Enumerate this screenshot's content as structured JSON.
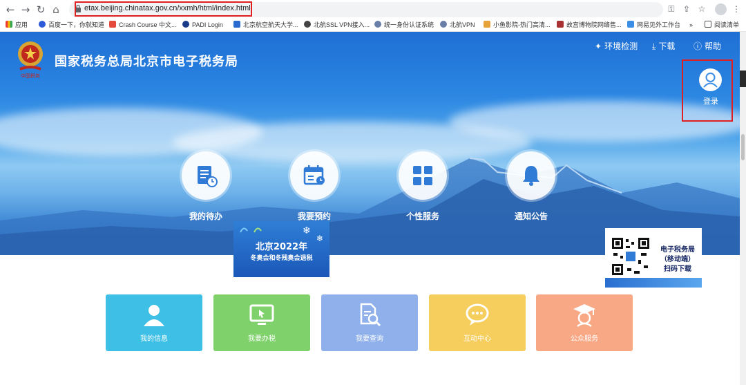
{
  "browser": {
    "url": "etax.beijing.chinatax.gov.cn/xxmh/html/index.html",
    "bookmarks": [
      "应用",
      "百度一下，你就知道",
      "Crash Course 中文...",
      "PADI Login",
      "北京航空航天大学...",
      "北航SSL VPN接入...",
      "统一身份认证系统",
      "北航VPN",
      "小鱼影院-热门高清...",
      "故宫博物院网络售...",
      "网易见外工作台",
      "»",
      "阅读清单"
    ],
    "colors": {
      "highlight": "#e02020"
    }
  },
  "site": {
    "title": "国家税务总局北京市电子税务局",
    "top_links": [
      "环境检测",
      "下载",
      "帮助"
    ],
    "login_label": "登录"
  },
  "features": [
    {
      "label": "我的待办",
      "icon": "document-clock-icon"
    },
    {
      "label": "我要预约",
      "icon": "calendar-clock-icon"
    },
    {
      "label": "个性服务",
      "icon": "grid-icon"
    },
    {
      "label": "通知公告",
      "icon": "bell-icon"
    }
  ],
  "banner": {
    "title": "北京2022年",
    "subtitle": "冬奥会和冬残奥会退税"
  },
  "qr_card": {
    "line1": "电子税务局",
    "line2": "（移动端）",
    "line3": "扫码下载"
  },
  "tiles": [
    {
      "label": "我的信息",
      "color": "#3dbfe6",
      "icon": "user-icon"
    },
    {
      "label": "我要办税",
      "color": "#7fd16b",
      "icon": "monitor-icon"
    },
    {
      "label": "我要查询",
      "color": "#8fb0ea",
      "icon": "search-document-icon"
    },
    {
      "label": "互动中心",
      "color": "#f5ce5e",
      "icon": "chat-icon"
    },
    {
      "label": "公众服务",
      "color": "#f9a886",
      "icon": "graduate-icon"
    }
  ]
}
